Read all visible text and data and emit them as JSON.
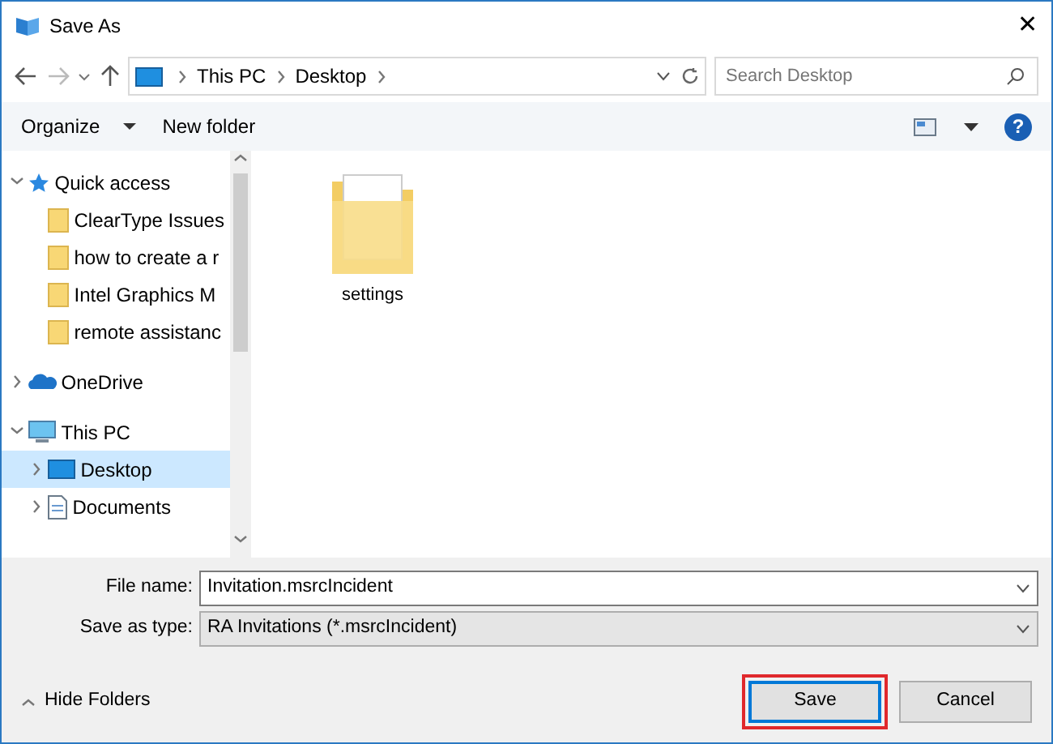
{
  "window": {
    "title": "Save As",
    "close": "✕"
  },
  "address": {
    "path": [
      "This PC",
      "Desktop"
    ],
    "search_placeholder": "Search Desktop"
  },
  "toolbar": {
    "organize": "Organize",
    "new_folder": "New folder",
    "help": "?"
  },
  "sidebar": {
    "items": [
      {
        "label": "Quick access",
        "kind": "star",
        "expanded": true,
        "selected": false,
        "children": [
          {
            "label": "ClearType Issues",
            "kind": "folder",
            "selected": false
          },
          {
            "label": "how to create a r",
            "kind": "folder",
            "selected": false
          },
          {
            "label": "Intel Graphics M",
            "kind": "folder",
            "selected": false
          },
          {
            "label": "remote assistanc",
            "kind": "folder",
            "selected": false
          }
        ]
      },
      {
        "label": "OneDrive",
        "kind": "cloud",
        "expanded": false,
        "selected": false
      },
      {
        "label": "This PC",
        "kind": "pc",
        "expanded": true,
        "selected": false,
        "children": [
          {
            "label": "Desktop",
            "kind": "desktop",
            "expanded": false,
            "selected": true
          },
          {
            "label": "Documents",
            "kind": "document",
            "expanded": false,
            "selected": false
          }
        ]
      }
    ]
  },
  "files": [
    {
      "name": "settings"
    }
  ],
  "form": {
    "file_name_label": "File name:",
    "file_name": "Invitation.msrcIncident",
    "type_label": "Save as type:",
    "type": "RA Invitations (*.msrcIncident)"
  },
  "hide_folders": "Hide Folders",
  "buttons": [
    {
      "label": "Save",
      "highlighted": true,
      "default": true
    },
    {
      "label": "Cancel",
      "highlighted": false,
      "default": false
    }
  ]
}
